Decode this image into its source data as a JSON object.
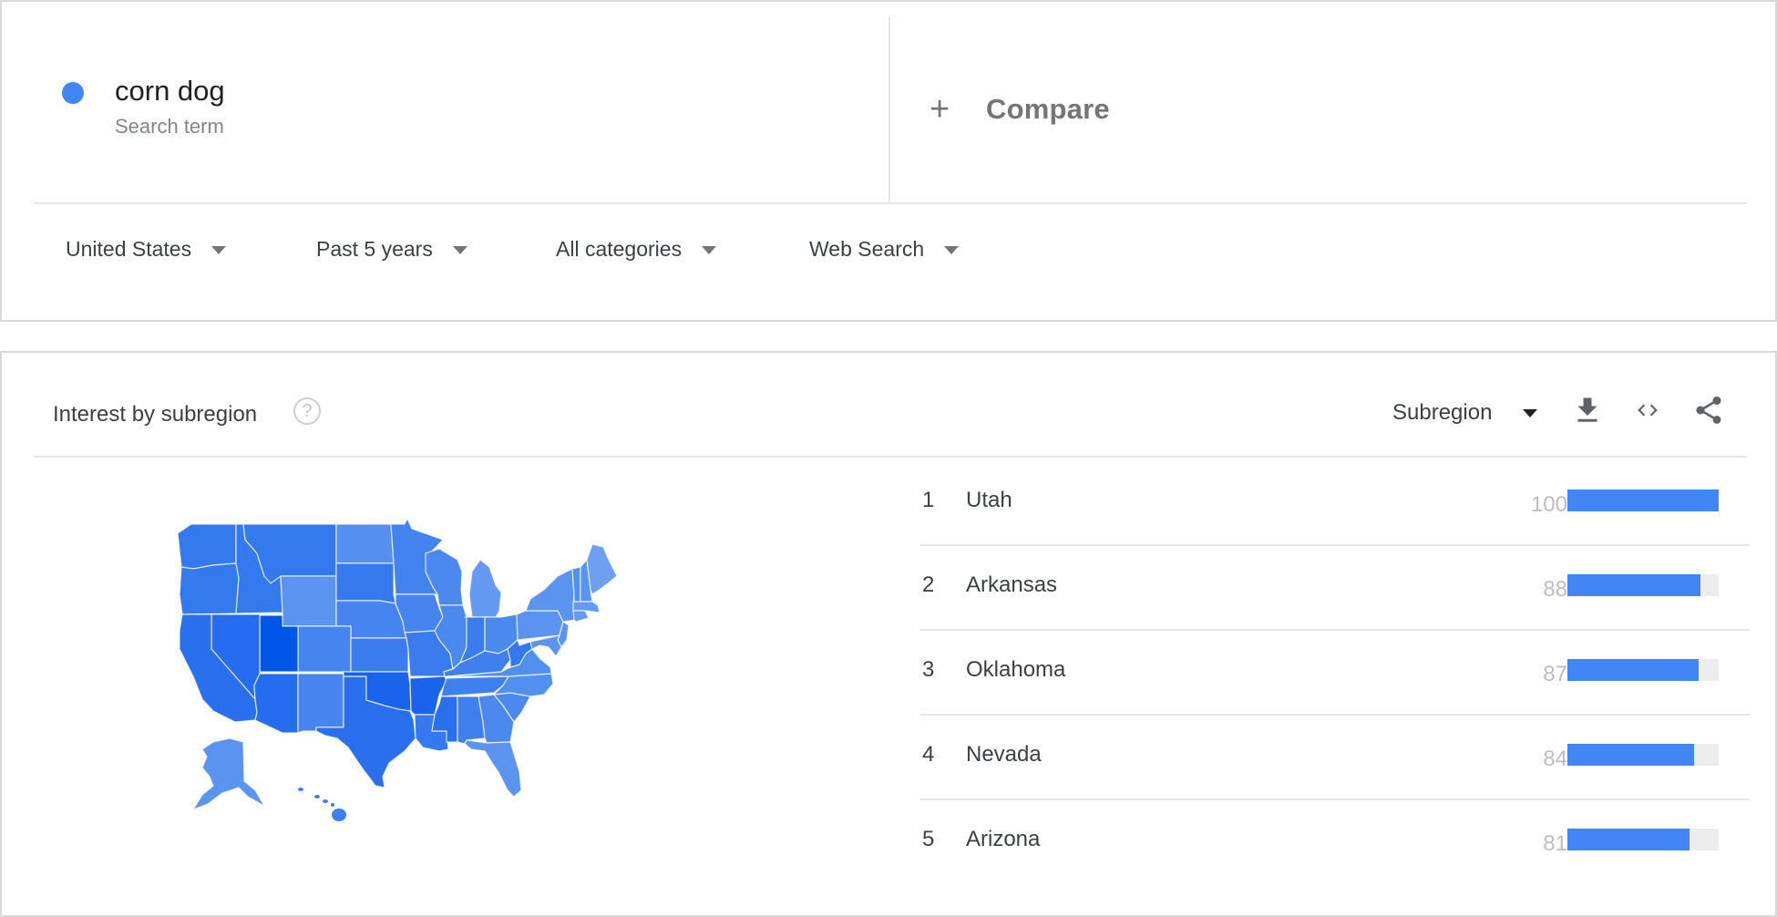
{
  "explore": {
    "term": {
      "name": "corn dog",
      "type": "Search term",
      "color": "#4285f4"
    },
    "compare": {
      "icon": "plus-icon",
      "label": "Compare"
    },
    "filters": [
      {
        "label": "United States",
        "icon": "caret-down-icon"
      },
      {
        "label": "Past 5 years",
        "icon": "caret-down-icon"
      },
      {
        "label": "All categories",
        "icon": "caret-down-icon"
      },
      {
        "label": "Web Search",
        "icon": "caret-down-icon"
      }
    ]
  },
  "geo": {
    "title": "Interest by subregion",
    "help_icon": "?",
    "resolution": "Subregion",
    "tools": [
      "download-icon",
      "embed-icon",
      "share-icon"
    ],
    "bar_color": "#4285f4",
    "ranking": [
      {
        "rank": "1",
        "name": "Utah",
        "value": 100
      },
      {
        "rank": "2",
        "name": "Arkansas",
        "value": 88
      },
      {
        "rank": "3",
        "name": "Oklahoma",
        "value": 87
      },
      {
        "rank": "4",
        "name": "Nevada",
        "value": 84
      },
      {
        "rank": "5",
        "name": "Arizona",
        "value": 81
      }
    ],
    "map": {
      "region": "United States",
      "state_colors": {
        "WA": "#3479ee",
        "OR": "#3479ee",
        "ID": "#3479ee",
        "MT": "#3479ee",
        "WY": "#5b94f0",
        "ND": "#558ff0",
        "SD": "#3479ee",
        "NE": "#4685ef",
        "CO": "#4685ef",
        "KS": "#3a7cee",
        "UT": "#0057e7",
        "NV": "#266cee",
        "CA": "#2a6fee",
        "AZ": "#266cee",
        "NM": "#4685ef",
        "TX": "#2a6fee",
        "OK": "#1a64ec",
        "AR": "#1a64ec",
        "LA": "#3479ee",
        "MN": "#4283ef",
        "IA": "#4685ef",
        "MO": "#3a7cee",
        "WI": "#4c89ef",
        "IL": "#4c89ef",
        "MI": "#649af0",
        "IN": "#3a7cee",
        "OH": "#4c89ef",
        "KY": "#3f80ee",
        "TN": "#3f80ee",
        "MS": "#2a6fee",
        "AL": "#3f80ee",
        "GA": "#4c89ef",
        "FL": "#5b94f0",
        "SC": "#4c89ef",
        "NC": "#5290f0",
        "VA": "#5290f0",
        "WV": "#3479ee",
        "PA": "#5b94f0",
        "NY": "#5b94f0",
        "NJ": "#5b94f0",
        "MD": "#5b94f0",
        "ME": "#6ea0f1",
        "VT": "#5290f0",
        "NH": "#5b94f0",
        "MA": "#649af0",
        "CT": "#649af0",
        "AK": "#5b94f0",
        "HI": "#3f80ee"
      }
    }
  }
}
